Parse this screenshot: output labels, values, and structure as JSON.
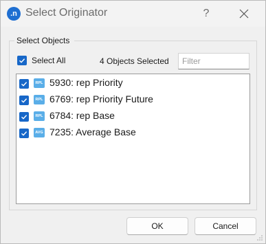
{
  "window": {
    "title": "Select Originator",
    "app_icon": ".n",
    "help_label": "?",
    "icons": {
      "app": "app-logo-icon",
      "close": "close-icon"
    }
  },
  "group": {
    "label": "Select Objects"
  },
  "toolbar": {
    "select_all_label": "Select All",
    "select_all_checked": true,
    "selected_count": "4 Objects Selected",
    "filter_placeholder": "Filter",
    "filter_value": ""
  },
  "objects": [
    {
      "label": "5930: rep Priority",
      "type": "RPL",
      "checked": true
    },
    {
      "label": "6769: rep Priority Future",
      "type": "RPL",
      "checked": true
    },
    {
      "label": "6784: rep Base",
      "type": "RPL",
      "checked": true
    },
    {
      "label": "7235: Average Base",
      "type": "AVG",
      "checked": true
    }
  ],
  "buttons": {
    "ok_label": "OK",
    "cancel_label": "Cancel"
  },
  "colors": {
    "accent": "#1767c8",
    "type_icon": "#5aaee8"
  }
}
